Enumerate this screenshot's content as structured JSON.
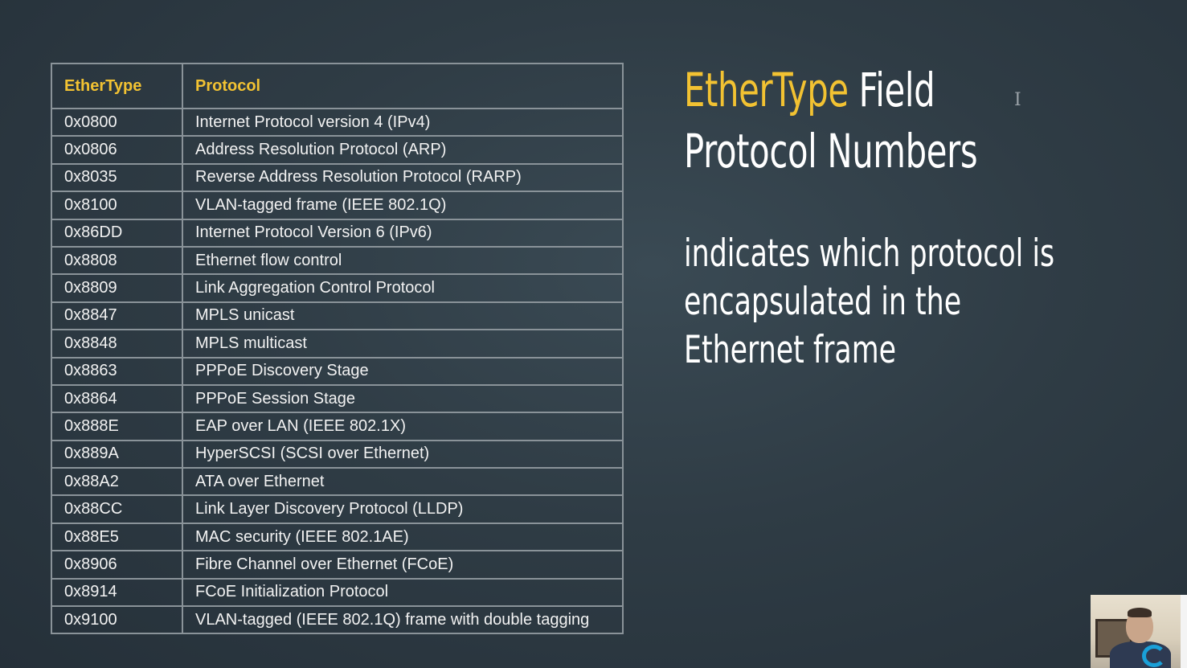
{
  "table": {
    "headers": [
      "EtherType",
      "Protocol"
    ],
    "rows": [
      [
        "0x0800",
        "Internet Protocol version 4 (IPv4)"
      ],
      [
        "0x0806",
        "Address Resolution Protocol (ARP)"
      ],
      [
        "0x8035",
        "Reverse Address Resolution Protocol (RARP)"
      ],
      [
        "0x8100",
        "VLAN-tagged frame (IEEE 802.1Q)"
      ],
      [
        "0x86DD",
        "Internet Protocol Version 6 (IPv6)"
      ],
      [
        "0x8808",
        "Ethernet flow control"
      ],
      [
        "0x8809",
        "Link Aggregation Control Protocol"
      ],
      [
        "0x8847",
        "MPLS unicast"
      ],
      [
        "0x8848",
        "MPLS multicast"
      ],
      [
        "0x8863",
        "PPPoE Discovery Stage"
      ],
      [
        "0x8864",
        "PPPoE Session Stage"
      ],
      [
        "0x888E",
        "EAP over LAN (IEEE 802.1X)"
      ],
      [
        "0x889A",
        "HyperSCSI (SCSI over Ethernet)"
      ],
      [
        "0x88A2",
        "ATA over Ethernet"
      ],
      [
        "0x88CC",
        "Link Layer Discovery Protocol (LLDP)"
      ],
      [
        "0x88E5",
        "MAC security (IEEE 802.1AE)"
      ],
      [
        "0x8906",
        "Fibre Channel over Ethernet (FCoE)"
      ],
      [
        "0x8914",
        "FCoE Initialization Protocol"
      ],
      [
        "0x9100",
        "VLAN-tagged (IEEE 802.1Q) frame with double tagging"
      ]
    ]
  },
  "title": {
    "accent": "EtherType",
    "rest_line1": " Field",
    "line2": "Protocol Numbers"
  },
  "subtitle": {
    "lines": [
      "indicates which protocol is",
      "encapsulated in the",
      "Ethernet frame"
    ]
  },
  "cursor": {
    "glyph": "I"
  },
  "colors": {
    "accent": "#f2c232",
    "background": "#2f3c45",
    "text": "#ffffff",
    "table_border": "#8a9399"
  }
}
